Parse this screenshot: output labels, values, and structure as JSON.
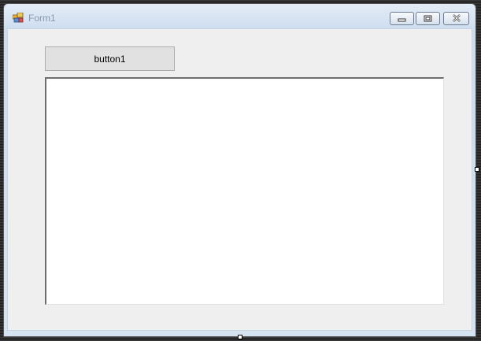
{
  "window": {
    "title": "Form1"
  },
  "controls": {
    "button1_label": "button1",
    "textbox_value": ""
  },
  "colors": {
    "title_text": "#8a9aab",
    "client_background": "#efefef",
    "button_background": "#e1e1e1",
    "textbox_background": "#ffffff"
  },
  "icons": {
    "app": "form-app-icon",
    "minimize": "minimize-icon",
    "maximize": "maximize-icon",
    "close": "close-icon"
  }
}
